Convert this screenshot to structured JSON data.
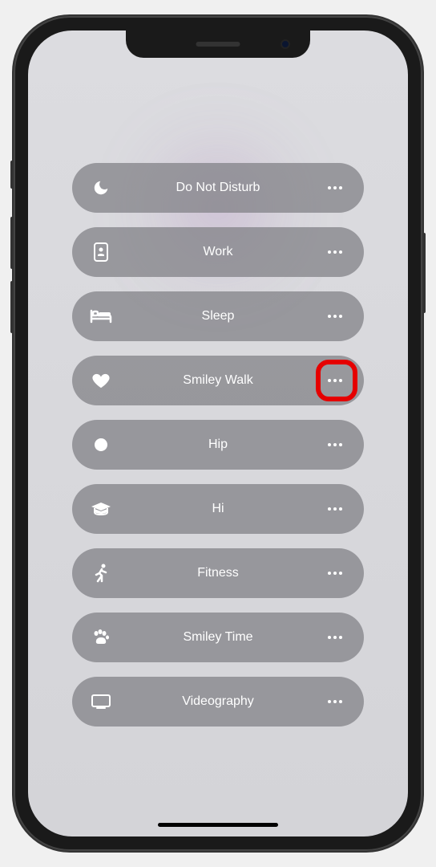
{
  "focus_modes": [
    {
      "id": "dnd",
      "label": "Do Not Disturb",
      "icon": "moon",
      "highlighted": false
    },
    {
      "id": "work",
      "label": "Work",
      "icon": "badge",
      "highlighted": false
    },
    {
      "id": "sleep",
      "label": "Sleep",
      "icon": "bed",
      "highlighted": false
    },
    {
      "id": "smiley-walk",
      "label": "Smiley Walk",
      "icon": "heart",
      "highlighted": true
    },
    {
      "id": "hip",
      "label": "Hip",
      "icon": "circle",
      "highlighted": false
    },
    {
      "id": "hi",
      "label": "Hi",
      "icon": "graduation",
      "highlighted": false
    },
    {
      "id": "fitness",
      "label": "Fitness",
      "icon": "running",
      "highlighted": false
    },
    {
      "id": "smiley-time",
      "label": "Smiley Time",
      "icon": "paw",
      "highlighted": false
    },
    {
      "id": "videography",
      "label": "Videography",
      "icon": "display",
      "highlighted": false
    }
  ]
}
